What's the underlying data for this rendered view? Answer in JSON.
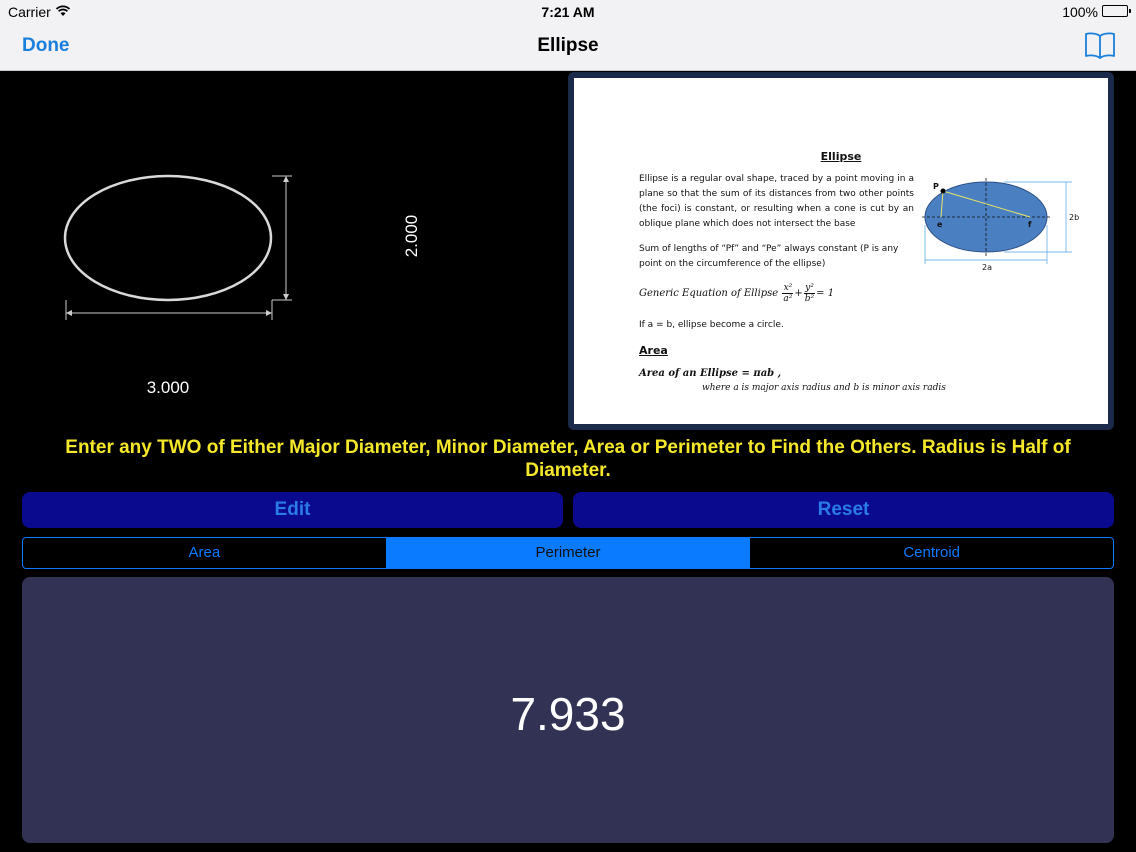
{
  "status": {
    "carrier": "Carrier",
    "time": "7:21 AM",
    "battery": "100%"
  },
  "nav": {
    "done": "Done",
    "title": "Ellipse"
  },
  "drawing": {
    "width_label": "3.000",
    "height_label": "2.000"
  },
  "doc": {
    "title": "Ellipse",
    "paragraph": "Ellipse is a regular oval shape, traced by a point moving in a plane so that the sum of its distances from two other points (the foci) is constant, or resulting when a cone is cut by an oblique plane which does not intersect the base",
    "sum_text": "Sum of lengths of “Pf” and “Pe” always constant (P is any point on the circumference of the ellipse)",
    "generic_label": "Generic Equation of Ellipse",
    "circle_text": "If a = b, ellipse become a circle.",
    "area_heading": "Area",
    "area_formula": "Area of an Ellipse = πab ,",
    "area_note": "where a is major axis radius and b is minor axis radis",
    "fig_labels": {
      "p": "P",
      "e": "e",
      "f": "f",
      "b": "2b",
      "a": "2a"
    }
  },
  "instruction": "Enter any TWO of Either Major Diameter, Minor Diameter, Area or Perimeter to Find the Others. Radius is Half of Diameter.",
  "buttons": {
    "edit": "Edit",
    "reset": "Reset"
  },
  "tabs": [
    {
      "label": "Area"
    },
    {
      "label": "Perimeter"
    },
    {
      "label": "Centroid"
    }
  ],
  "selected_tab": "Perimeter",
  "result": {
    "value": "7.933"
  }
}
